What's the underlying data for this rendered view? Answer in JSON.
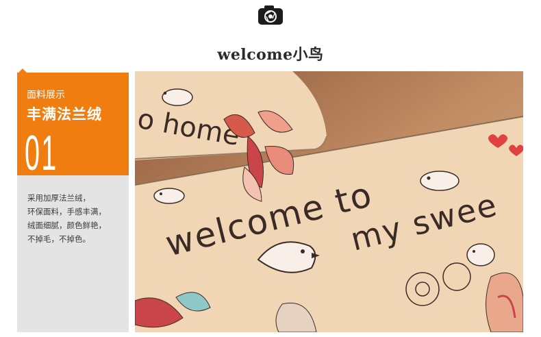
{
  "header": {
    "title": "welcome小鸟"
  },
  "feature": {
    "label": "面料展示",
    "title": "丰满法兰绒",
    "number": "01",
    "description": [
      "采用加厚法兰绒，",
      "环保面料，手感丰满，",
      "绒面细腻，颜色鲜艳，",
      "不掉毛，不掉色。"
    ]
  },
  "photo": {
    "mat_back_text": "o home",
    "mat_front_line1": "welcome to",
    "mat_front_line2": "my swee"
  },
  "colors": {
    "accent": "#ef7d10",
    "panel_grey": "#e4e4e4",
    "table_wood": "#b9825b",
    "mat_beige": "#f0d5b5"
  },
  "icons": {
    "header_icon": "camera-icon"
  }
}
